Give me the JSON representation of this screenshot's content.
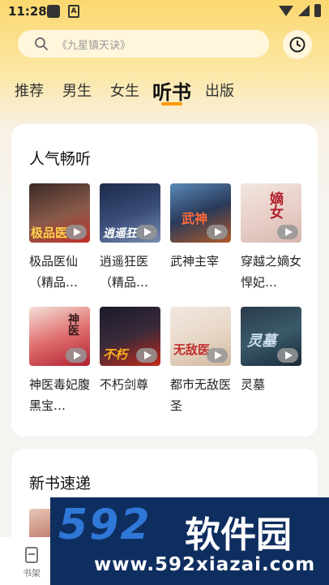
{
  "status_bar": {
    "time": "11:28",
    "icon_a": "A"
  },
  "search": {
    "placeholder": "《九星镇天诀》"
  },
  "tabs": [
    {
      "label": "推荐"
    },
    {
      "label": "男生"
    },
    {
      "label": "女生"
    },
    {
      "label": "听书",
      "active": true
    },
    {
      "label": "出版"
    }
  ],
  "popular": {
    "title": "人气畅听",
    "books": [
      {
        "title": "极品医仙（精品…",
        "cover_text": "极品医"
      },
      {
        "title": "逍遥狂医（精品…",
        "cover_text": "逍遥狂"
      },
      {
        "title": "武神主宰",
        "cover_text": "武神"
      },
      {
        "title": "穿越之嫡女悍妃…",
        "cover_text": "嫡女"
      },
      {
        "title": "神医毒妃腹黑宝…",
        "cover_text": "神医"
      },
      {
        "title": "不朽剑尊",
        "cover_text": "不朽"
      },
      {
        "title": "都市无敌医圣",
        "cover_text": "无敌医"
      },
      {
        "title": "灵墓",
        "cover_text": "灵墓"
      }
    ]
  },
  "new_books": {
    "title": "新书速递"
  },
  "bottom_nav": {
    "bookshelf_label": "书架"
  },
  "watermark": {
    "big": "592",
    "cn": "软件园",
    "url": "www.592xiazai.com"
  },
  "colors": {
    "accent": "#ff9800",
    "header_bg": "#fbd86f"
  }
}
